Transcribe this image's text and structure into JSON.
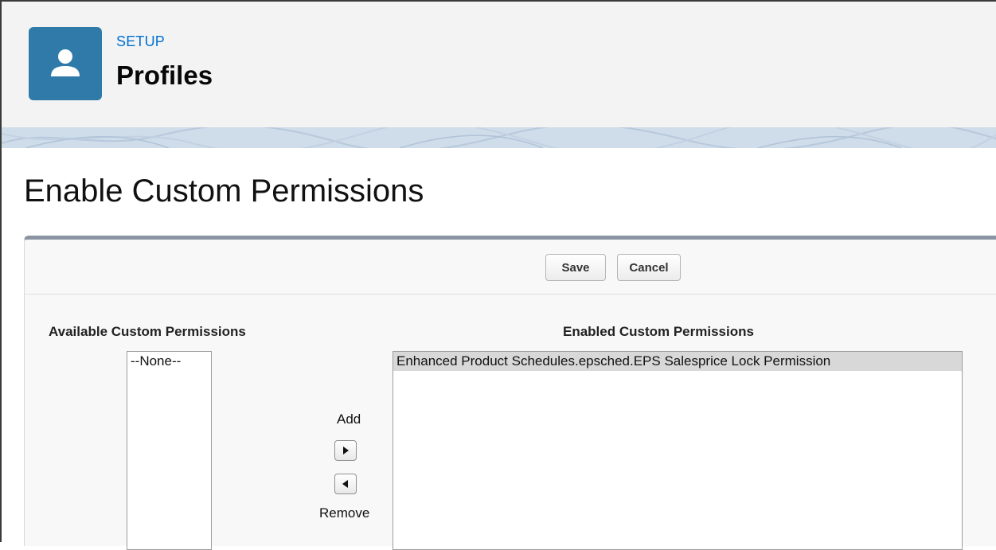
{
  "header": {
    "setup_label": "SETUP",
    "title": "Profiles",
    "icon": "user-icon",
    "icon_color": "#2f7aa8",
    "accent_color": "#0070d2"
  },
  "page": {
    "title": "Enable Custom Permissions"
  },
  "toolbar": {
    "save_label": "Save",
    "cancel_label": "Cancel"
  },
  "available": {
    "title": "Available Custom Permissions",
    "options": [
      "--None--"
    ]
  },
  "enabled": {
    "title": "Enabled Custom Permissions",
    "options": [
      "Enhanced Product Schedules.epsched.EPS Salesprice Lock Permission"
    ]
  },
  "transfer": {
    "add_label": "Add",
    "remove_label": "Remove",
    "add_icon": "arrow-right-icon",
    "remove_icon": "arrow-left-icon"
  }
}
